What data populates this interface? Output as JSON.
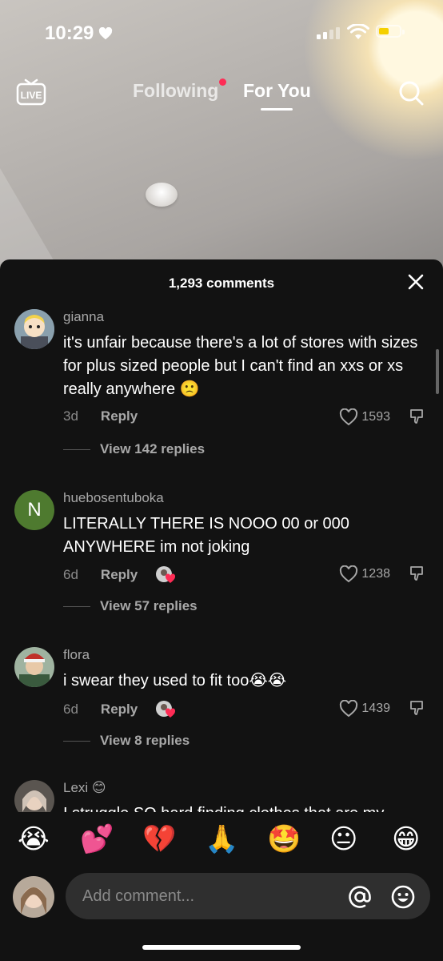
{
  "status_bar": {
    "time": "10:29"
  },
  "topnav": {
    "live_label": "LIVE",
    "tab_following": "Following",
    "tab_foryou": "For You"
  },
  "panel": {
    "comment_count": "1,293 comments"
  },
  "comments": [
    {
      "username": "gianna",
      "text": "it's unfair because there's a lot of stores with sizes for plus sized people but I can't find an xxs or xs really anywhere 🙁",
      "age": "3d",
      "reply_label": "Reply",
      "likes": "1593",
      "view_replies": "View 142 replies"
    },
    {
      "username": "huebosentuboka",
      "avatar_letter": "N",
      "text": "LITERALLY THERE IS NOOO 00 or 000 ANYWHERE im not joking",
      "age": "6d",
      "reply_label": "Reply",
      "likes": "1238",
      "view_replies": "View 57 replies"
    },
    {
      "username": "flora",
      "text": "i swear they used to fit too😭😭",
      "age": "6d",
      "reply_label": "Reply",
      "likes": "1439",
      "view_replies": "View 8 replies"
    },
    {
      "username": "Lexi 😊",
      "text": "I struggle SO hard finding clothes that are my"
    }
  ],
  "emoji_bar": [
    "😭",
    "💕",
    "💔",
    "🙏",
    "🤩",
    "😐",
    "😁"
  ],
  "input": {
    "placeholder": "Add comment..."
  },
  "colors": {
    "accent": "#fe2c55",
    "panel_bg": "#121212",
    "input_bg": "#2f2f2f"
  }
}
